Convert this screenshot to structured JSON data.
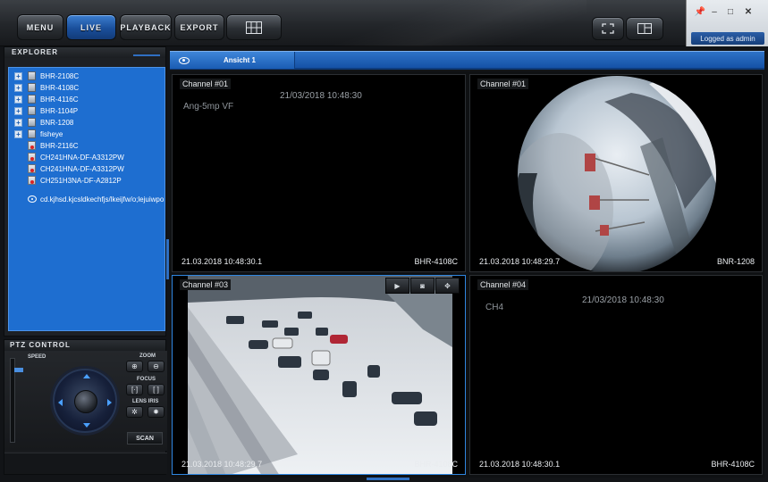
{
  "nav": {
    "menu": "MENU",
    "live": "LIVE",
    "playback": "PLAYBACK",
    "export": "EXPORT"
  },
  "window": {
    "login_status": "Logged as admin",
    "pin_icon": "pin-icon",
    "minimize": "–",
    "maximize": "□",
    "close": "✕"
  },
  "explorer": {
    "title": "EXPLORER",
    "groups": [
      {
        "label": "BHR-2108C"
      },
      {
        "label": "BHR-4108C"
      },
      {
        "label": "BHR-4116C"
      },
      {
        "label": "BHR-1104P"
      },
      {
        "label": "BNR-1208"
      },
      {
        "label": "fisheye"
      }
    ],
    "cameras": [
      {
        "label": "BHR-2116C"
      },
      {
        "label": "CH241HNA-DF-A3312PW"
      },
      {
        "label": "CH241HNA-DF-A3312PW"
      },
      {
        "label": "CH251H3NA-DF-A2812P"
      }
    ],
    "view_link": "cd.kjhsd.kjcsldkechfjs/lkeijfw/o;lejuiwpo;e"
  },
  "ptz": {
    "title": "PTZ CONTROL",
    "speed": "SPEED",
    "zoom": "ZOOM",
    "focus": "FOCUS",
    "lens_iris": "LENS IRIS",
    "scan": "SCAN"
  },
  "view": {
    "tab_label": "Ansicht 1"
  },
  "tiles": [
    {
      "label": "Channel #01",
      "overlay_timestamp": "21/03/2018 10:48:30",
      "overlay_name": "Ang-5mp VF",
      "timestamp": "21.03.2018 10:48:30.1",
      "source": "BHR-4108C"
    },
    {
      "label": "Channel #01",
      "timestamp": "21.03.2018 10:48:29.7",
      "source": "BNR-1208"
    },
    {
      "label": "Channel #03",
      "timestamp": "21.03.2018 10:48:29.7",
      "source": "BHR-4108C"
    },
    {
      "label": "Channel #04",
      "overlay_timestamp": "21/03/2018 10:48:30",
      "overlay_name": "CH4",
      "timestamp": "21.03.2018 10:48:30.1",
      "source": "BHR-4108C"
    }
  ],
  "colors": {
    "accent_blue": "#1e6ed0",
    "tab_blue": "#2e72c8",
    "selected_border": "#2f86e0"
  }
}
